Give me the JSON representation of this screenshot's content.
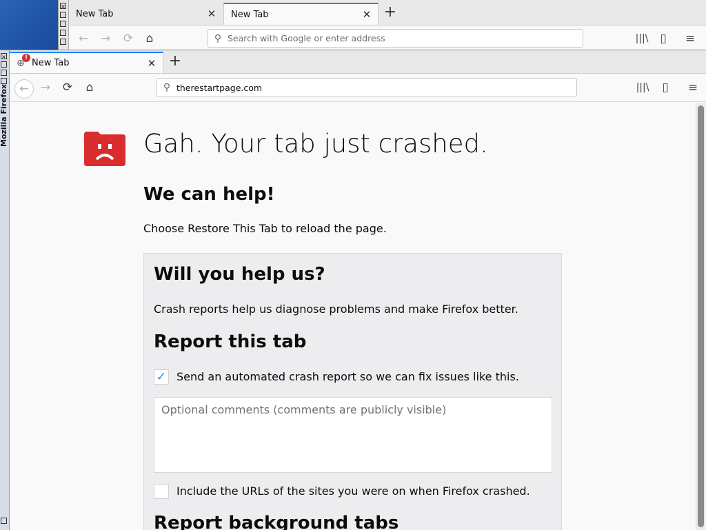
{
  "back_window": {
    "tabs": [
      {
        "label": "New Tab",
        "selected": false
      },
      {
        "label": "New Tab",
        "selected": true
      }
    ],
    "url_placeholder": "Search with Google or enter address"
  },
  "front_window": {
    "vertical_title": "Mozilla Firefox",
    "tab": {
      "label": "New Tab",
      "badge": "!"
    },
    "url_value": "therestartpage.com"
  },
  "crash_page": {
    "title": "Gah. Your tab just crashed.",
    "help_heading": "We can help!",
    "help_text": "Choose Restore This Tab to reload the page.",
    "help_us_heading": "Will you help us?",
    "help_us_text": "Crash reports help us diagnose problems and make Firefox better.",
    "report_heading": "Report this tab",
    "send_report_label": "Send an automated crash report so we can fix issues like this.",
    "send_report_checked": true,
    "comments_placeholder": "Optional comments (comments are publicly visible)",
    "include_urls_label": "Include the URLs of the sites you were on when Firefox crashed.",
    "include_urls_checked": false,
    "background_heading": "Report background tabs"
  },
  "colors": {
    "accent": "#0a84ff",
    "sad_icon": "#d92d2d",
    "desktop": "#1f4f94"
  }
}
